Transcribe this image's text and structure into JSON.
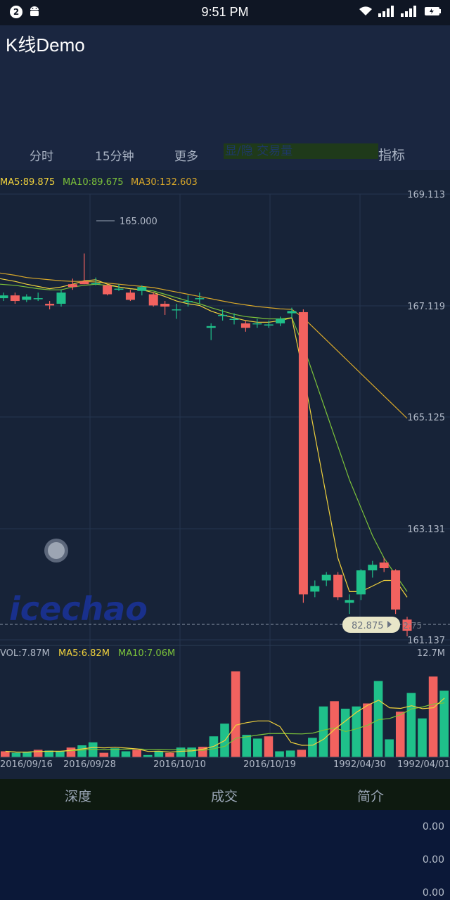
{
  "status_bar": {
    "time": "9:51 PM",
    "notification_count": "2"
  },
  "app": {
    "title": "K线Demo"
  },
  "tabs": {
    "timeshare": "分时",
    "fifteen_min": "15分钟",
    "more": "更多",
    "toggle_volume": "显/隐 交易量",
    "indicators": "指标"
  },
  "ma_legend": {
    "ma5": "MA5:89.875",
    "ma10": "MA10:89.675",
    "ma30": "MA30:132.603"
  },
  "price_axis": [
    "169.113",
    "167.119",
    "165.125",
    "163.131",
    "161.137"
  ],
  "high_marker": "165.000",
  "current_price_label": "82.875",
  "current_price_right": "2.75",
  "watermark": "icechao",
  "vol_legend": {
    "vol": "VOL:7.87M",
    "ma5": "MA5:6.82M",
    "ma10": "MA10:7.06M",
    "max": "12.7M"
  },
  "date_axis": [
    "2016/09/16",
    "2016/09/28",
    "2016/10/10",
    "2016/10/19",
    "1992/04/30",
    "1992/04/01"
  ],
  "bottom_tabs": {
    "depth": "深度",
    "trades": "成交",
    "intro": "简介"
  },
  "depth_values": [
    "0.00",
    "0.00",
    "0.00"
  ],
  "colors": {
    "up": "#1fc08a",
    "down": "#f2625f",
    "ma5": "#f1d23c",
    "ma10": "#7cc33a",
    "ma30": "#d9a82a",
    "grid": "#24364f"
  },
  "chart_data": {
    "type": "candlestick",
    "ylim": [
      161.137,
      169.113
    ],
    "candles": [
      {
        "o": 167.25,
        "c": 167.3,
        "h": 167.35,
        "l": 167.2
      },
      {
        "o": 167.3,
        "c": 167.2,
        "h": 167.35,
        "l": 167.15
      },
      {
        "o": 167.22,
        "c": 167.28,
        "h": 167.32,
        "l": 167.18
      },
      {
        "o": 167.25,
        "c": 167.25,
        "h": 167.35,
        "l": 167.2
      },
      {
        "o": 167.15,
        "c": 167.12,
        "h": 167.2,
        "l": 167.05
      },
      {
        "o": 167.15,
        "c": 167.35,
        "h": 167.4,
        "l": 167.1
      },
      {
        "o": 167.5,
        "c": 167.45,
        "h": 167.6,
        "l": 167.4
      },
      {
        "o": 167.55,
        "c": 167.5,
        "h": 168.05,
        "l": 167.5
      },
      {
        "o": 167.52,
        "c": 167.52,
        "h": 167.62,
        "l": 167.48
      },
      {
        "o": 167.48,
        "c": 167.32,
        "h": 167.5,
        "l": 167.3
      },
      {
        "o": 167.42,
        "c": 167.42,
        "h": 167.5,
        "l": 167.38
      },
      {
        "o": 167.35,
        "c": 167.22,
        "h": 167.4,
        "l": 167.2
      },
      {
        "o": 167.38,
        "c": 167.45,
        "h": 167.48,
        "l": 167.3
      },
      {
        "o": 167.32,
        "c": 167.12,
        "h": 167.35,
        "l": 167.1
      },
      {
        "o": 167.15,
        "c": 167.1,
        "h": 167.2,
        "l": 166.95
      },
      {
        "o": 167.05,
        "c": 167.05,
        "h": 167.15,
        "l": 166.88
      },
      {
        "o": 167.2,
        "c": 167.2,
        "h": 167.3,
        "l": 167.1
      },
      {
        "o": 167.25,
        "c": 167.25,
        "h": 167.35,
        "l": 167.15
      },
      {
        "o": 166.72,
        "c": 166.75,
        "h": 166.8,
        "l": 166.5
      },
      {
        "o": 166.95,
        "c": 166.95,
        "h": 167.05,
        "l": 166.85
      },
      {
        "o": 166.88,
        "c": 166.88,
        "h": 166.98,
        "l": 166.78
      },
      {
        "o": 166.8,
        "c": 166.72,
        "h": 166.85,
        "l": 166.65
      },
      {
        "o": 166.8,
        "c": 166.8,
        "h": 166.88,
        "l": 166.72
      },
      {
        "o": 166.78,
        "c": 166.78,
        "h": 166.85,
        "l": 166.72
      },
      {
        "o": 166.8,
        "c": 166.88,
        "h": 166.92,
        "l": 166.75
      },
      {
        "o": 166.98,
        "c": 167.02,
        "h": 167.08,
        "l": 166.9
      },
      {
        "o": 167.0,
        "c": 161.95,
        "h": 167.05,
        "l": 161.8
      },
      {
        "o": 162.0,
        "c": 162.1,
        "h": 162.2,
        "l": 161.9
      },
      {
        "o": 162.2,
        "c": 162.3,
        "h": 162.35,
        "l": 162.1
      },
      {
        "o": 162.3,
        "c": 161.9,
        "h": 162.35,
        "l": 161.85
      },
      {
        "o": 161.8,
        "c": 161.85,
        "h": 161.95,
        "l": 161.6
      },
      {
        "o": 161.95,
        "c": 162.38,
        "h": 162.4,
        "l": 161.85
      },
      {
        "o": 162.38,
        "c": 162.48,
        "h": 162.55,
        "l": 162.25
      },
      {
        "o": 162.52,
        "c": 162.42,
        "h": 162.6,
        "l": 162.35
      },
      {
        "o": 162.38,
        "c": 161.68,
        "h": 162.4,
        "l": 161.6
      },
      {
        "o": 161.5,
        "c": 161.3,
        "h": 161.55,
        "l": 161.2
      }
    ],
    "ma5": [
      167.6,
      167.55,
      167.5,
      167.46,
      167.42,
      167.45,
      167.5,
      167.56,
      167.58,
      167.5,
      167.45,
      167.42,
      167.4,
      167.35,
      167.28,
      167.2,
      167.15,
      167.12,
      167.02,
      166.95,
      166.9,
      166.85,
      166.82,
      166.82,
      166.85,
      166.9,
      165.9,
      164.8,
      163.7,
      162.6,
      162.0,
      162.0,
      162.1,
      162.2,
      162.2,
      161.9
    ],
    "ma10": [
      167.5,
      167.48,
      167.45,
      167.42,
      167.4,
      167.4,
      167.45,
      167.48,
      167.5,
      167.48,
      167.45,
      167.42,
      167.4,
      167.38,
      167.32,
      167.26,
      167.2,
      167.15,
      167.08,
      167.02,
      166.96,
      166.92,
      166.9,
      166.88,
      166.88,
      166.9,
      166.4,
      165.8,
      165.2,
      164.6,
      164.0,
      163.5,
      163.0,
      162.6,
      162.3,
      162.0
    ],
    "ma30": [
      167.7,
      167.66,
      167.62,
      167.6,
      167.58,
      167.56,
      167.55,
      167.55,
      167.54,
      167.52,
      167.5,
      167.48,
      167.46,
      167.44,
      167.4,
      167.36,
      167.32,
      167.28,
      167.24,
      167.2,
      167.16,
      167.13,
      167.1,
      167.08,
      167.06,
      167.05,
      166.9,
      166.7,
      166.5,
      166.3,
      166.1,
      165.9,
      165.7,
      165.5,
      165.3,
      165.1
    ],
    "volume": [
      0.8,
      0.6,
      0.7,
      1.0,
      0.9,
      0.8,
      1.3,
      1.6,
      2.0,
      0.6,
      1.2,
      0.8,
      1.0,
      0.3,
      0.8,
      0.6,
      1.3,
      1.3,
      1.4,
      2.8,
      4.5,
      11.5,
      3.0,
      2.5,
      2.8,
      0.8,
      0.9,
      1.0,
      2.6,
      6.8,
      7.5,
      6.5,
      6.8,
      7.2,
      10.2,
      2.4,
      6.1,
      8.6,
      5.2,
      10.8,
      8.9
    ]
  }
}
